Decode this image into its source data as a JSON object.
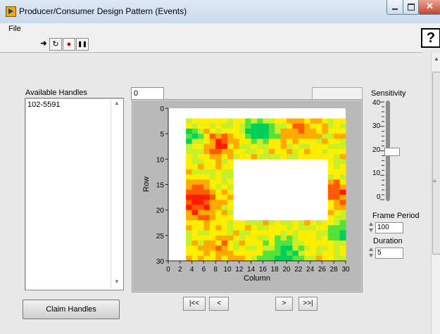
{
  "window": {
    "title": "Producer/Consumer Design Pattern (Events)"
  },
  "menu": [
    "File"
  ],
  "toolbar": {
    "icons": [
      "run-arrow-icon",
      "run-continuously-icon",
      "abort-icon",
      "pause-icon"
    ],
    "glyphs": [
      "➜",
      "↻",
      "●",
      "❚❚"
    ],
    "context_help": "?",
    "help_glyph": "?"
  },
  "handles": {
    "label": "Available Handles",
    "items": [
      "102-5591"
    ],
    "claim_label": "Claim Handles"
  },
  "frame_index": "0",
  "nav": {
    "first": "|<<",
    "prev": "<",
    "next": ">",
    "last": ">>|"
  },
  "sensitivity": {
    "label": "Sensitivity",
    "value": 20,
    "min": 0,
    "max": 40,
    "ticks": [
      "40",
      "30",
      "20",
      "10",
      "0"
    ]
  },
  "frame_period": {
    "label": "Frame Period",
    "value": "100"
  },
  "duration": {
    "label": "Duration",
    "value": "5"
  },
  "chart_data": {
    "type": "heatmap",
    "title": "",
    "xlabel": "Column",
    "ylabel": "Row",
    "xlim": [
      0,
      30
    ],
    "ylim": [
      30,
      0
    ],
    "x_ticks": [
      "0",
      "2",
      "4",
      "6",
      "8",
      "10",
      "12",
      "14",
      "16",
      "18",
      "20",
      "22",
      "24",
      "26",
      "28",
      "30"
    ],
    "y_ticks": [
      "0",
      "5",
      "10",
      "15",
      "20",
      "25",
      "30"
    ],
    "data_extent": {
      "col_start": 3,
      "col_end": 30,
      "row_start": 2,
      "row_end": 30
    },
    "blank_region": {
      "col_start": 11,
      "col_end": 27,
      "row_start": 10,
      "row_end": 22
    },
    "colors": [
      "#00d05a",
      "#55e23a",
      "#c8ef27",
      "#ffee00",
      "#ffaa00",
      "#ff5c00",
      "#ff1a00"
    ]
  }
}
